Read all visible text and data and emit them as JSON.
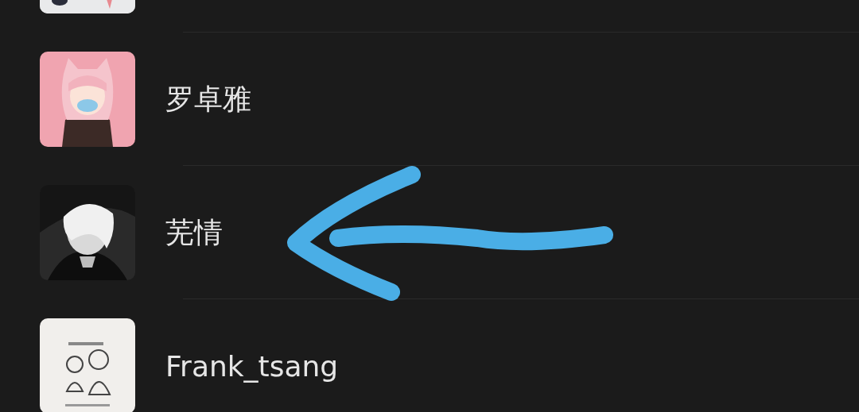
{
  "contacts": [
    {
      "avatar": {
        "kind": "picture"
      }
    },
    {
      "name": "罗卓雅",
      "avatar": {
        "kind": "picture"
      }
    },
    {
      "name": "芜情",
      "avatar": {
        "kind": "picture"
      }
    },
    {
      "name": "Frank_tsang",
      "avatar": {
        "kind": "picture"
      }
    }
  ],
  "annotation": {
    "kind": "arrow"
  }
}
